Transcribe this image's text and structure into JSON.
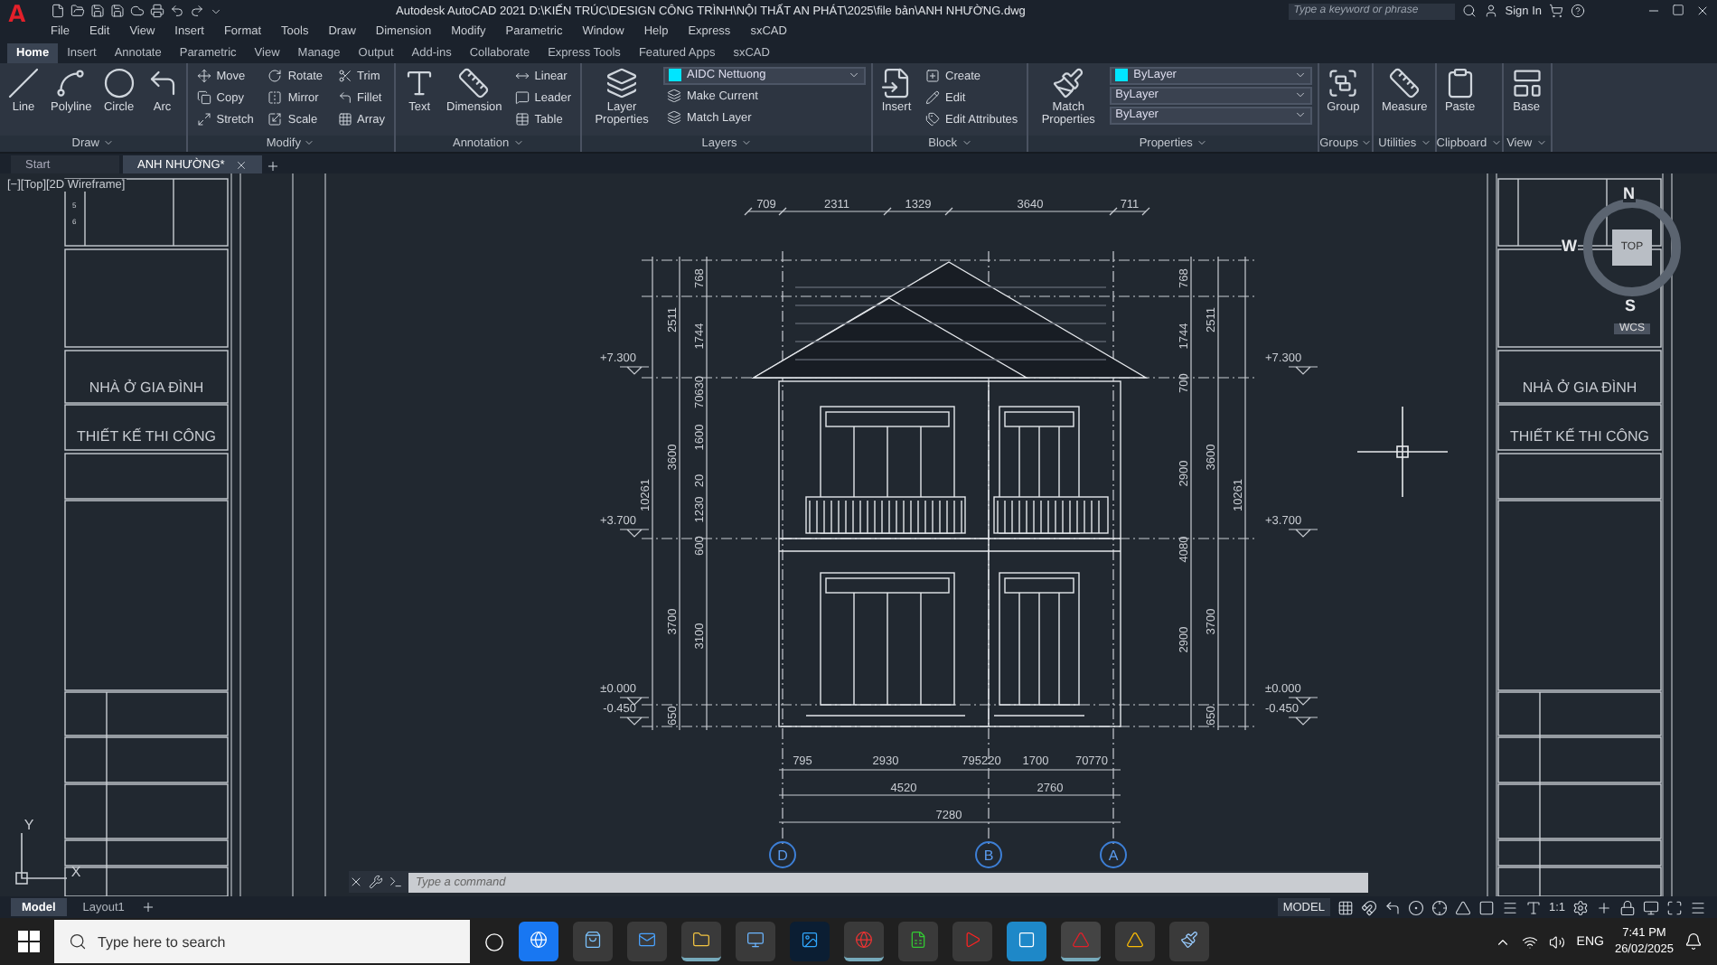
{
  "title_bar": {
    "logo": "A",
    "title": "Autodesk AutoCAD 2021   D:\\KIẾN TRÚC\\DESIGN CÔNG TRÌNH\\NỘI THẤT AN PHÁT\\2025\\file bản\\ANH NHƯỜNG.dwg",
    "search": {
      "placeholder": "Type a keyword or phrase"
    },
    "sign_in": "Sign In"
  },
  "menu": [
    "File",
    "Edit",
    "View",
    "Insert",
    "Format",
    "Tools",
    "Draw",
    "Dimension",
    "Modify",
    "Parametric",
    "Window",
    "Help",
    "Express",
    "sxCAD"
  ],
  "ribbon_tabs": [
    {
      "label": "Home",
      "selected": true
    },
    {
      "label": "Insert",
      "selected": false
    },
    {
      "label": "Annotate",
      "selected": false
    },
    {
      "label": "Parametric",
      "selected": false
    },
    {
      "label": "View",
      "selected": false
    },
    {
      "label": "Manage",
      "selected": false
    },
    {
      "label": "Output",
      "selected": false
    },
    {
      "label": "Add-ins",
      "selected": false
    },
    {
      "label": "Collaborate",
      "selected": false
    },
    {
      "label": "Express Tools",
      "selected": false
    },
    {
      "label": "Featured Apps",
      "selected": false
    },
    {
      "label": "sxCAD",
      "selected": false
    }
  ],
  "ribbon_panels": [
    {
      "title": "Draw",
      "tools": [
        {
          "kind": "large",
          "label": "Line"
        },
        {
          "kind": "large",
          "label": "Polyline"
        },
        {
          "kind": "large",
          "label": "Circle"
        },
        {
          "kind": "large",
          "label": "Arc"
        }
      ]
    },
    {
      "title": "Modify",
      "tools": [
        {
          "kind": "small",
          "label": "Move"
        },
        {
          "kind": "small",
          "label": "Copy"
        },
        {
          "kind": "small",
          "label": "Stretch"
        },
        {
          "kind": "small",
          "label": "Rotate"
        },
        {
          "kind": "small",
          "label": "Mirror"
        },
        {
          "kind": "small",
          "label": "Scale"
        },
        {
          "kind": "small",
          "label": "Trim"
        },
        {
          "kind": "small",
          "label": "Fillet"
        },
        {
          "kind": "small",
          "label": "Array"
        }
      ]
    },
    {
      "title": "Annotation",
      "tools": [
        {
          "kind": "large",
          "label": "Text"
        },
        {
          "kind": "large",
          "label": "Dimension"
        },
        {
          "kind": "small",
          "label": "Linear"
        },
        {
          "kind": "small",
          "label": "Leader"
        },
        {
          "kind": "small",
          "label": "Table"
        }
      ]
    },
    {
      "title": "Layers",
      "tools": [
        {
          "kind": "large",
          "label": "Layer Properties"
        },
        {
          "kind": "dropdown",
          "label": "AIDC Nettuong",
          "color": "#00e5ff"
        },
        {
          "kind": "small",
          "label": "Make Current"
        },
        {
          "kind": "small",
          "label": "Match Layer"
        }
      ]
    },
    {
      "title": "Block",
      "tools": [
        {
          "kind": "large",
          "label": "Insert"
        },
        {
          "kind": "small",
          "label": "Create"
        },
        {
          "kind": "small",
          "label": "Edit"
        },
        {
          "kind": "small",
          "label": "Edit Attributes"
        }
      ]
    },
    {
      "title": "Properties",
      "tools": [
        {
          "kind": "large",
          "label": "Match Properties"
        },
        {
          "kind": "dropdown",
          "label": "ByLayer",
          "color": "#00e5ff"
        },
        {
          "kind": "dropdown",
          "label": "ByLayer"
        },
        {
          "kind": "dropdown",
          "label": "ByLayer"
        }
      ]
    },
    {
      "title": "Groups",
      "tools": [
        {
          "kind": "large",
          "label": "Group"
        }
      ]
    },
    {
      "title": "Utilities",
      "tools": [
        {
          "kind": "large",
          "label": "Measure"
        }
      ]
    },
    {
      "title": "Clipboard",
      "tools": [
        {
          "kind": "large",
          "label": "Paste"
        }
      ]
    },
    {
      "title": "View",
      "tools": [
        {
          "kind": "large",
          "label": "Base"
        }
      ]
    }
  ],
  "doc_tabs": [
    {
      "label": "Start",
      "selected": false
    },
    {
      "label": "ANH NHƯỜNG*",
      "selected": true
    }
  ],
  "viewport_label": "[−][Top][2D Wireframe]",
  "title_block_left": {
    "rows": [
      "5",
      "6"
    ],
    "project": "NHÀ Ở GIA ĐÌNH",
    "stage": "THIẾT KẾ THI CÔNG"
  },
  "title_block_right": {
    "project": "NHÀ Ở GIA ĐÌNH",
    "stage": "THIẾT KẾ THI CÔNG"
  },
  "drawing": {
    "top_dims": [
      "709",
      "2311",
      "1329",
      "3640",
      "711"
    ],
    "left_dims": [
      "10261",
      "2511",
      "3600",
      "3700",
      "650",
      "768",
      "1744",
      "70630",
      "1600",
      "20",
      "1230",
      "600",
      "3100"
    ],
    "right_dims": [
      "768",
      "1744",
      "700",
      "2900",
      "4080",
      "2900",
      "2511",
      "3600",
      "3700",
      "650",
      "10261"
    ],
    "bottom_dims": [
      "795",
      "2930",
      "795220",
      "1700",
      "70770",
      "4520",
      "2760",
      "7280"
    ],
    "left_levels": [
      "+7.300",
      "+3.700",
      "±0.000",
      "-0.450"
    ],
    "right_levels": [
      "+7.300",
      "+3.700",
      "±0.000",
      "-0.450"
    ],
    "axes": [
      "D",
      "B",
      "A"
    ]
  },
  "viewcube": {
    "north": "N",
    "west": "W",
    "south": "S",
    "top": "TOP",
    "wcs": "WCS"
  },
  "ucs": {
    "x": "X",
    "y": "Y"
  },
  "command_line": {
    "placeholder": "Type a command"
  },
  "layout_tabs": [
    {
      "label": "Model",
      "selected": true
    },
    {
      "label": "Layout1",
      "selected": false
    }
  ],
  "status_bar": {
    "mode": "MODEL",
    "scale": "1:1"
  },
  "taskbar": {
    "search": {
      "placeholder": "Type here to search"
    },
    "language": "ENG",
    "time": "7:41 PM",
    "date": "26/02/2025"
  }
}
